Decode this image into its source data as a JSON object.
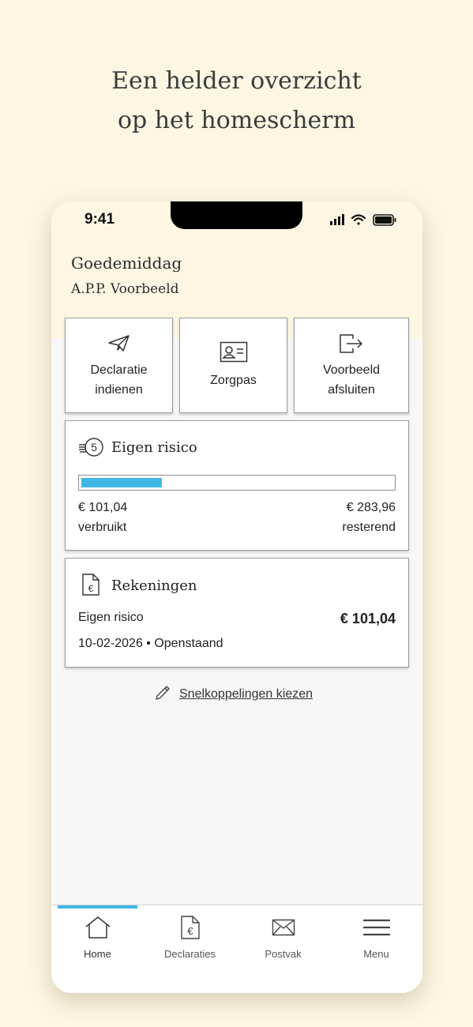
{
  "headline": {
    "line1": "Een helder overzicht",
    "line2": "op het homescherm"
  },
  "status_bar": {
    "time": "9:41"
  },
  "greeting": "Goedemiddag",
  "user_name": "A.P.P. Voorbeeld",
  "quick_actions": [
    {
      "label": "Declaratie\nindienen",
      "icon": "paper-plane-icon"
    },
    {
      "label": "Zorgpas",
      "icon": "id-card-icon"
    },
    {
      "label": "Voorbeeld\nafsluiten",
      "icon": "logout-icon"
    }
  ],
  "eigen_risico": {
    "title": "Eigen risico",
    "icon": "coins-5-icon",
    "used_amount": "€ 101,04",
    "used_label": "verbruikt",
    "remaining_amount": "€ 283,96",
    "remaining_label": "resterend",
    "progress_fraction": 0.26
  },
  "rekeningen": {
    "title": "Rekeningen",
    "icon": "invoice-euro-icon",
    "item_label": "Eigen risico",
    "item_amount": "€ 101,04",
    "item_meta": "10-02-2026 • Openstaand"
  },
  "shortcut_link": {
    "label": "Snelkoppelingen kiezen",
    "icon": "pencil-icon"
  },
  "tabbar": [
    {
      "label": "Home",
      "icon": "home-icon",
      "active": true
    },
    {
      "label": "Declaraties",
      "icon": "invoice-euro-icon",
      "active": false
    },
    {
      "label": "Postvak",
      "icon": "envelope-icon",
      "active": false
    },
    {
      "label": "Menu",
      "icon": "hamburger-menu-icon",
      "active": false
    }
  ],
  "colors": {
    "background": "#fdf6e2",
    "accent": "#3fb8e4",
    "card_border": "#9c9c9c"
  }
}
